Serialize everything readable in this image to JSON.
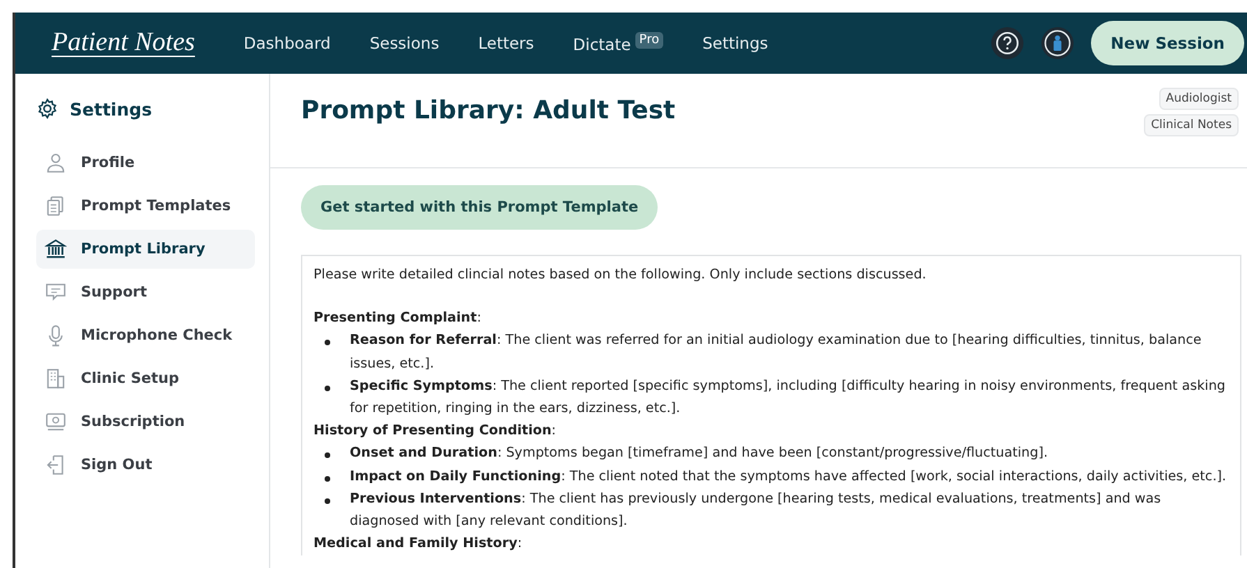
{
  "header": {
    "logo": "Patient Notes",
    "nav": [
      {
        "label": "Dashboard",
        "selected": false
      },
      {
        "label": "Sessions",
        "selected": false
      },
      {
        "label": "Letters",
        "selected": false
      },
      {
        "label": "Dictate",
        "badge": "Pro",
        "selected": false
      },
      {
        "label": "Settings",
        "selected": false
      }
    ],
    "new_session": "New Session"
  },
  "sidebar": {
    "title": "Settings",
    "items": [
      {
        "label": "Profile",
        "selected": false
      },
      {
        "label": "Prompt Templates",
        "selected": false
      },
      {
        "label": "Prompt Library",
        "selected": true
      },
      {
        "label": "Support",
        "selected": false
      },
      {
        "label": "Microphone Check",
        "selected": false
      },
      {
        "label": "Clinic Setup",
        "selected": false
      },
      {
        "label": "Subscription",
        "selected": false
      },
      {
        "label": "Sign Out",
        "selected": false
      }
    ]
  },
  "page": {
    "title": "Prompt Library: Adult Test",
    "tags": [
      "Audiologist",
      "Clinical Notes"
    ],
    "start_button": "Get started with this Prompt Template",
    "prompt": [
      {
        "kind": "paragraph",
        "text": "Please write detailed clincial notes based on the following. Only include sections discussed."
      },
      {
        "kind": "heading",
        "text": "**Presenting Complaint**:"
      },
      {
        "kind": "bullet",
        "text": "**Reason for Referral**: The client was referred for an initial audiology examination due to [hearing difficulties, tinnitus, balance issues, etc.]."
      },
      {
        "kind": "bullet",
        "text": "**Specific Symptoms**: The client reported [specific symptoms], including [difficulty hearing in noisy environments, frequent asking for repetition, ringing in the ears, dizziness, etc.]."
      },
      {
        "kind": "heading",
        "text": "**History of Presenting Condition**:"
      },
      {
        "kind": "bullet",
        "text": "**Onset and Duration**: Symptoms began [timeframe] and have been [constant/progressive/fluctuating]."
      },
      {
        "kind": "bullet",
        "text": "**Impact on Daily Functioning**: The client noted that the symptoms have affected [work, social interactions, daily activities, etc.]."
      },
      {
        "kind": "bullet",
        "text": "**Previous Interventions**: The client has previously undergone [hearing tests, medical evaluations, treatments] and was diagnosed with [any relevant conditions]."
      },
      {
        "kind": "heading",
        "text": "**Medical and Family History**:"
      }
    ]
  }
}
